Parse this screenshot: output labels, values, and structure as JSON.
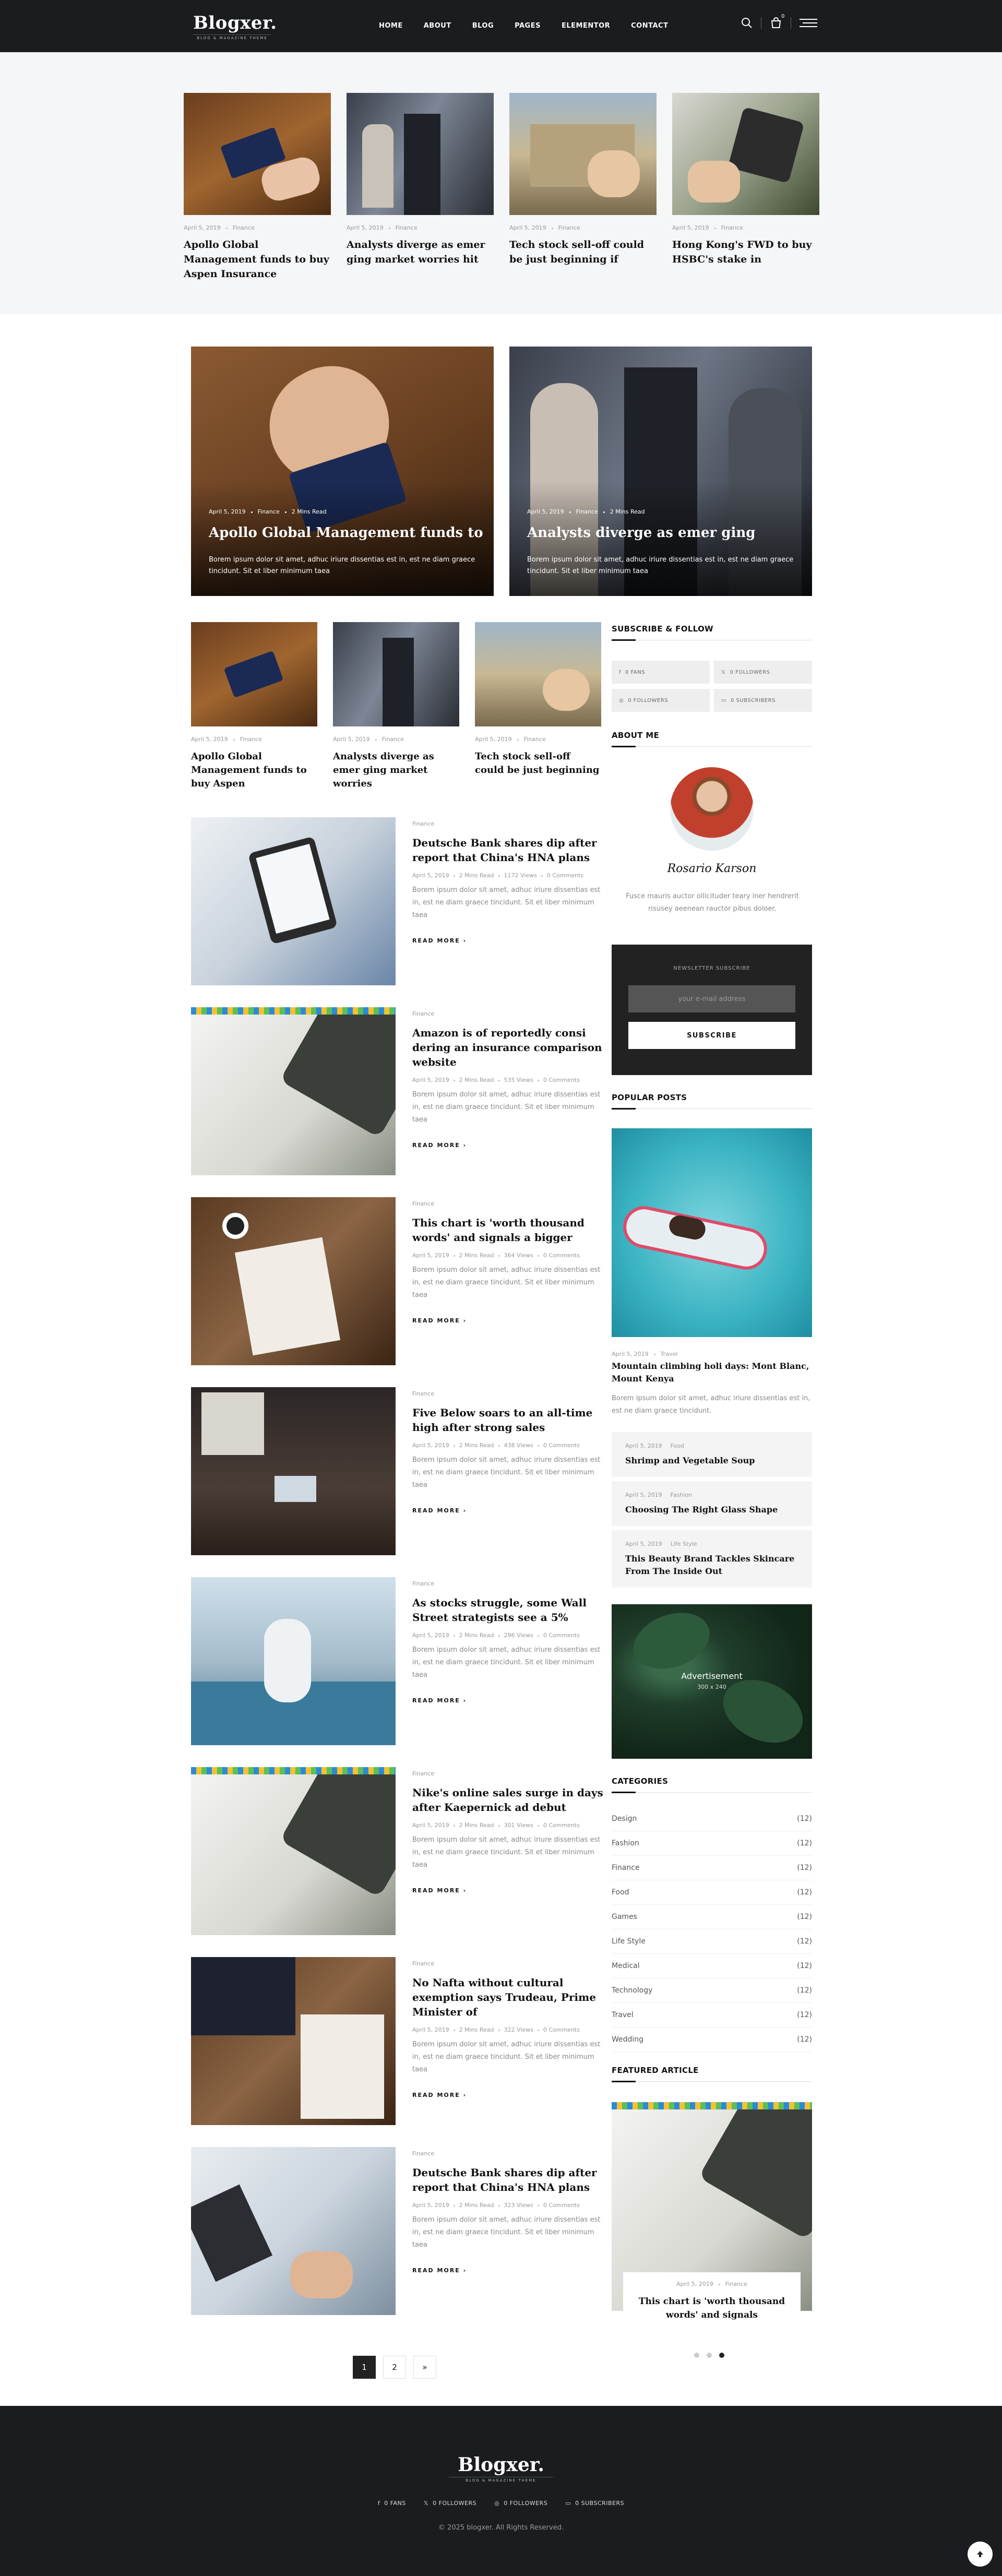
{
  "header": {
    "logo": "Blogxer.",
    "tagline": "BLOG & MAGAZINE THEME",
    "nav": [
      "HOME",
      "ABOUT",
      "BLOG",
      "PAGES",
      "ELEMENTOR",
      "CONTACT"
    ],
    "cart_count": "0"
  },
  "strip": [
    {
      "date": "April 5, 2019",
      "cat": "Finance",
      "title": "Apollo Global Management funds to buy Aspen Insurance"
    },
    {
      "date": "April 5, 2019",
      "cat": "Finance",
      "title": "Analysts diverge as emer ging market worries hit"
    },
    {
      "date": "April 5, 2019",
      "cat": "Finance",
      "title": "Tech stock sell-off could be just beginning if"
    },
    {
      "date": "April 5, 2019",
      "cat": "Finance",
      "title": "Hong Kong's FWD to buy HSBC's stake in"
    }
  ],
  "heroes": [
    {
      "date": "April 5, 2019",
      "cat": "Finance",
      "read": "2 Mins Read",
      "title": "Apollo Global Management funds to",
      "excerpt": "Borem ipsum dolor sit amet, adhuc iriure dissentias est in, est ne diam graece tincidunt. Sit et liber minimum taea"
    },
    {
      "date": "April 5, 2019",
      "cat": "Finance",
      "read": "2 Mins Read",
      "title": "Analysts diverge as emer ging",
      "excerpt": "Borem ipsum dolor sit amet, adhuc iriure dissentias est in, est ne diam graece tincidunt. Sit et liber minimum taea"
    }
  ],
  "mini": [
    {
      "date": "April 5, 2019",
      "cat": "Finance",
      "title": "Apollo Global Management funds to buy Aspen"
    },
    {
      "date": "April 5, 2019",
      "cat": "Finance",
      "title": "Analysts diverge as emer ging market worries"
    },
    {
      "date": "April 5, 2019",
      "cat": "Finance",
      "title": "Tech stock sell-off could be just beginning"
    }
  ],
  "list": [
    {
      "cat": "Finance",
      "title": "Deutsche Bank shares dip after report that China's HNA plans",
      "date": "April 5, 2019",
      "read": "2 Mins Read",
      "views": "1172 Views",
      "comments": "0 Comments"
    },
    {
      "cat": "Finance",
      "title": "Amazon is of reportedly consi dering an insurance comparison website",
      "date": "April 5, 2019",
      "read": "2 Mins Read",
      "views": "535 Views",
      "comments": "0 Comments"
    },
    {
      "cat": "Finance",
      "title": "This chart is 'worth thousand words' and signals a bigger",
      "date": "April 5, 2019",
      "read": "2 Mins Read",
      "views": "364 Views",
      "comments": "0 Comments"
    },
    {
      "cat": "Finance",
      "title": "Five Below soars to an all-time high after strong sales",
      "date": "April 5, 2019",
      "read": "2 Mins Read",
      "views": "438 Views",
      "comments": "0 Comments"
    },
    {
      "cat": "Finance",
      "title": "As stocks struggle, some Wall Street strategists see a 5%",
      "date": "April 5, 2019",
      "read": "2 Mins Read",
      "views": "296 Views",
      "comments": "0 Comments"
    },
    {
      "cat": "Finance",
      "title": "Nike's online sales surge in days after Kaepernick ad debut",
      "date": "April 5, 2019",
      "read": "2 Mins Read",
      "views": "301 Views",
      "comments": "0 Comments"
    },
    {
      "cat": "Finance",
      "title": "No Nafta without cultural exemption says Trudeau, Prime Minister of",
      "date": "April 5, 2019",
      "read": "2 Mins Read",
      "views": "322 Views",
      "comments": "0 Comments"
    },
    {
      "cat": "Finance",
      "title": "Deutsche Bank shares dip after report that China's HNA plans",
      "date": "April 5, 2019",
      "read": "2 Mins Read",
      "views": "323 Views",
      "comments": "0 Comments"
    }
  ],
  "list_excerpt": "Borem ipsum dolor sit amet, adhuc iriure dissentias est in, est ne diam graece tincidunt. Sit et liber minimum taea",
  "read_more": "READ MORE",
  "sidebar": {
    "subscribe_title": "SUBSCRIBE & FOLLOW",
    "social": [
      "0  FANS",
      "0  FOLLOWERS",
      "0  FOLLOWERS",
      "0  SUBSCRIBERS"
    ],
    "about_title": "ABOUT ME",
    "about_name": "Rosario Karson",
    "about_text": "Fusce mauris auctor ollicituder teary iner hendrerit risusey aeenean rauctor pibus doloer.",
    "newsletter_label": "NEWSLETTER SUBSCRIBE",
    "newsletter_placeholder": "your e-mail address",
    "newsletter_button": "SUBSCRIBE",
    "popular_title": "POPULAR POSTS",
    "popular_main": {
      "date": "April 5, 2019",
      "cat": "Travel",
      "title": "Mountain climbing holi days: Mont Blanc, Mount Kenya",
      "excerpt": "Borem ipsum dolor sit amet, adhuc iriure dissentias est in, est ne diam graece tincidunt."
    },
    "popular": [
      {
        "date": "April 5, 2019",
        "cat": "Food",
        "title": "Shrimp and Vegetable Soup"
      },
      {
        "date": "April 5, 2019",
        "cat": "Fashion",
        "title": "Choosing The Right Glass Shape"
      },
      {
        "date": "April 5, 2019",
        "cat": "Life Style",
        "title": "This Beauty Brand Tackles Skincare From The Inside Out"
      }
    ],
    "ad_label": "Advertisement",
    "ad_size": "300 x 240",
    "categories_title": "CATEGORIES",
    "categories": [
      {
        "name": "Design",
        "count": "(12)"
      },
      {
        "name": "Fashion",
        "count": "(12)"
      },
      {
        "name": "Finance",
        "count": "(12)"
      },
      {
        "name": "Food",
        "count": "(12)"
      },
      {
        "name": "Games",
        "count": "(12)"
      },
      {
        "name": "Life Style",
        "count": "(12)"
      },
      {
        "name": "Medical",
        "count": "(12)"
      },
      {
        "name": "Technology",
        "count": "(12)"
      },
      {
        "name": "Travel",
        "count": "(12)"
      },
      {
        "name": "Wedding",
        "count": "(12)"
      }
    ],
    "featured_title": "FEATURED ARTICLE",
    "featured": {
      "date": "April 5, 2019",
      "cat": "Finance",
      "title": "This chart is 'worth thousand words' and signals"
    }
  },
  "pagination": [
    "1",
    "2",
    "»"
  ],
  "footer": {
    "logo": "Blogxer.",
    "tagline": "BLOG & MAGAZINE THEME",
    "social": [
      "0  FANS",
      "0  FOLLOWERS",
      "0  FOLLOWERS",
      "0  SUBSCRIBERS"
    ],
    "copyright": "© 2025 blogxer. All Rights Reserved."
  },
  "colors": {
    "dark": "#1b1c20",
    "light_bg": "#f5f6f8",
    "accent": "#222222"
  },
  "icons": [
    "search-icon",
    "cart-icon",
    "menu-icon",
    "facebook-icon",
    "x-icon",
    "instagram-icon",
    "youtube-icon",
    "arrow-up-icon"
  ]
}
